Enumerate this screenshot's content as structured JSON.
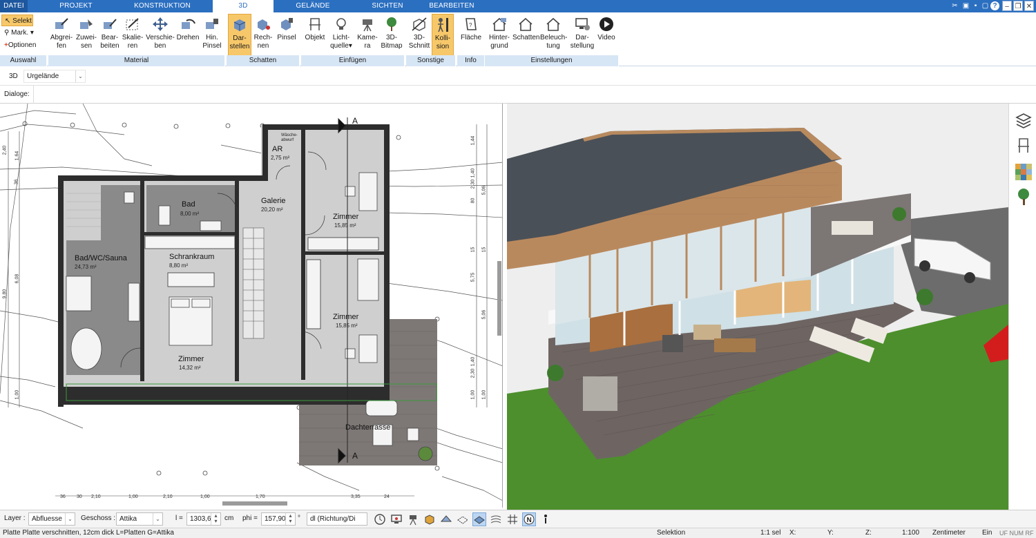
{
  "menu": {
    "file": "DATEI",
    "tabs": [
      "PROJEKT",
      "KONSTRUKTION",
      "3D",
      "GELÄNDE",
      "SICHTEN",
      "BEARBEITEN"
    ],
    "active": "3D"
  },
  "ribbon": {
    "auswahl": {
      "selekt": "Selekt",
      "mark": "Mark.",
      "optionen": "Optionen",
      "label": "Auswahl"
    },
    "material": {
      "label": "Material",
      "buttons": [
        {
          "l1": "Abgrei-",
          "l2": "fen"
        },
        {
          "l1": "Zuwei-",
          "l2": "sen"
        },
        {
          "l1": "Bear-",
          "l2": "beiten"
        },
        {
          "l1": "Skalie-",
          "l2": "ren"
        },
        {
          "l1": "Verschie-",
          "l2": "ben"
        },
        {
          "l1": "Drehen",
          "l2": ""
        },
        {
          "l1": "Hin.",
          "l2": "Pinsel"
        }
      ]
    },
    "schatten": {
      "label": "Schatten",
      "buttons": [
        {
          "l1": "Dar-",
          "l2": "stellen"
        },
        {
          "l1": "Rech-",
          "l2": "nen"
        },
        {
          "l1": "Pinsel",
          "l2": ""
        }
      ]
    },
    "einfuegen": {
      "label": "Einfügen",
      "buttons": [
        {
          "l1": "Objekt",
          "l2": ""
        },
        {
          "l1": "Licht-",
          "l2": "quelle"
        },
        {
          "l1": "Kame-",
          "l2": "ra"
        },
        {
          "l1": "3D-",
          "l2": "Bitmap"
        }
      ]
    },
    "sonstige": {
      "label": "Sonstige",
      "buttons": [
        {
          "l1": "3D-",
          "l2": "Schnitt"
        },
        {
          "l1": "Kolli-",
          "l2": "sion"
        }
      ]
    },
    "info": {
      "label": "Info",
      "buttons": [
        {
          "l1": "Fläche",
          "l2": ""
        }
      ]
    },
    "einstellungen": {
      "label": "Einstellungen",
      "buttons": [
        {
          "l1": "Hinter-",
          "l2": "grund"
        },
        {
          "l1": "Schatten",
          "l2": ""
        },
        {
          "l1": "Beleuch-",
          "l2": "tung"
        },
        {
          "l1": "Dar-",
          "l2": "stellung"
        },
        {
          "l1": "Video",
          "l2": ""
        }
      ]
    }
  },
  "viewbar": {
    "mode": "3D",
    "terrain": "Urgelände"
  },
  "dialogbar": {
    "label": "Dialoge:"
  },
  "plan": {
    "rooms": [
      {
        "name": "Bad",
        "area": "8,00 m²"
      },
      {
        "name": "Galerie",
        "area": "20,20 m²"
      },
      {
        "name": "Zimmer",
        "area": "15,85 m²"
      },
      {
        "name": "Bad/WC/Sauna",
        "area": "24,73 m²"
      },
      {
        "name": "Schrankraum",
        "area": "8,80 m²"
      },
      {
        "name": "Zimmer",
        "area": "15,85 m²"
      },
      {
        "name": "Zimmer",
        "area": "14,32 m²"
      },
      {
        "name": "AR",
        "area": "2,75 m²"
      },
      {
        "name": "Dachterrasse",
        "area": ""
      }
    ],
    "waesche": "Wäsche-\nabwurf",
    "section_marks": [
      "A",
      "A"
    ],
    "dims_right": [
      "1,44",
      "1,40",
      "2,30",
      "80",
      "15",
      "5,06",
      "15",
      "5,75",
      "5,06",
      "1,40",
      "2,30",
      "1,00",
      "1,00"
    ],
    "dims_left": [
      "2,40",
      "1,64",
      "36",
      "6,08",
      "9,80",
      "1,00"
    ],
    "dims_bottom": [
      "36",
      "30",
      "2,10",
      "1,00",
      "2,10",
      "1,00",
      "1,70",
      "3,35",
      "24"
    ]
  },
  "propbar": {
    "layer_label": "Layer :",
    "layer_value": "Abfluesse",
    "geschoss_label": "Geschoss :",
    "geschoss_value": "Attika",
    "l_label": "l =",
    "l_value": "1303,6",
    "l_unit": "cm",
    "phi_label": "phi =",
    "phi_value": "157,90",
    "phi_unit": "°",
    "direction": "dl (Richtung/Di"
  },
  "status": {
    "message": "Platte Platte verschnitten, 12cm dick L=Platten G=Attika",
    "mode": "Selektion",
    "sel": "1:1 sel",
    "x": "X:",
    "y": "Y:",
    "z": "Z:",
    "scale": "1:100",
    "unit": "Zentimeter",
    "insert": "Ein",
    "flags": "UF NUM RF"
  },
  "colors": {
    "menu_bg": "#2b6fc0",
    "group_bg": "#d7e6f5",
    "selected_btn": "#f7c86a",
    "wall": "#2d2d2d",
    "floor_tile": "#c9c9c9",
    "lawn": "#4a8f2b",
    "deck": "#6d6561",
    "roof": "#4a5057",
    "cladding": "#b88a5e"
  }
}
